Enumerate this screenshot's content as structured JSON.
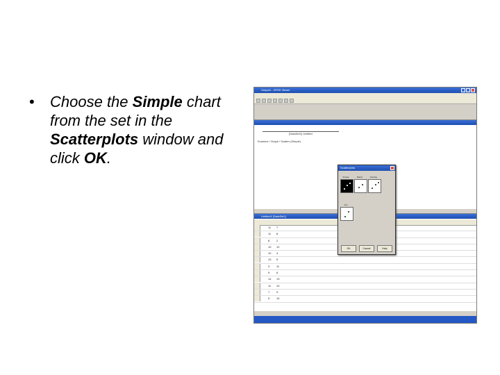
{
  "slide": {
    "bullet_symbol": "•",
    "text_1": "Choose the ",
    "bold_1": "Simple",
    "text_2": " chart from the set in the ",
    "bold_2": "Scatterplots",
    "text_3": " window and click ",
    "bold_3": "OK",
    "text_4": "."
  },
  "app": {
    "title": "Output1 - SPSS Viewer",
    "output_heading": "[DataSet1] Untitled",
    "output_line": "Examine / Graph / Scatter (Simple)",
    "data_title": "Untitled1 [DataSet1]"
  },
  "dialog": {
    "title": "Scatterplots",
    "options": [
      "Simple",
      "Matrix",
      "Overlay",
      "3-D"
    ],
    "ok_label": "OK",
    "cancel_label": "Cancel",
    "help_label": "Help"
  },
  "data_rows": [
    {
      "c1": "11",
      "c2": "7"
    },
    {
      "c1": "11",
      "c2": "8"
    },
    {
      "c1": "8",
      "c2": "2"
    },
    {
      "c1": "10",
      "c2": "12"
    },
    {
      "c1": "10",
      "c2": "4"
    },
    {
      "c1": "13",
      "c2": "5"
    },
    {
      "c1": "3",
      "c2": "11"
    },
    {
      "c1": "9",
      "c2": "6"
    },
    {
      "c1": "14",
      "c2": "13"
    },
    {
      "c1": "11",
      "c2": "10"
    },
    {
      "c1": "7",
      "c2": "9"
    },
    {
      "c1": "5",
      "c2": "14"
    }
  ],
  "colors": {
    "titlebar": "#1e4fb0",
    "statusbar": "#2458c4"
  }
}
